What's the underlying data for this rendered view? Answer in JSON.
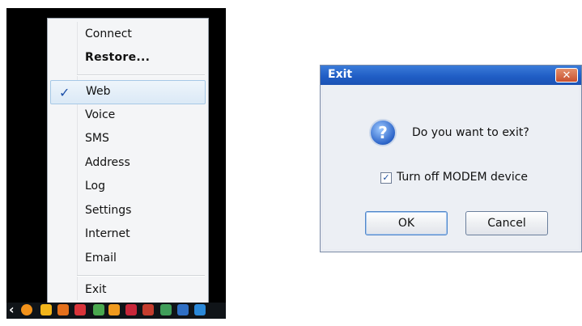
{
  "context_menu": {
    "items": [
      {
        "label": "Connect",
        "bold": false,
        "checked": false
      },
      {
        "label": "Restore...",
        "bold": true,
        "checked": false
      },
      {
        "label": "Web",
        "bold": false,
        "checked": true
      },
      {
        "label": "Voice",
        "bold": false,
        "checked": false
      },
      {
        "label": "SMS",
        "bold": false,
        "checked": false
      },
      {
        "label": "Address",
        "bold": false,
        "checked": false
      },
      {
        "label": "Log",
        "bold": false,
        "checked": false
      },
      {
        "label": "Settings",
        "bold": false,
        "checked": false
      },
      {
        "label": "Internet",
        "bold": false,
        "checked": false
      },
      {
        "label": "Email",
        "bold": false,
        "checked": false
      },
      {
        "label": "Exit",
        "bold": false,
        "checked": false
      }
    ],
    "check_glyph": "✓"
  },
  "taskbar": {
    "expand_glyph": "‹",
    "tray_icons": [
      "orange-round-icon",
      "clock-icon",
      "flame-icon",
      "shield-icon",
      "network-icon",
      "modem-icon",
      "cross-icon",
      "user-icon",
      "display-icon",
      "language-icon"
    ]
  },
  "exit_dialog": {
    "title": "Exit",
    "close_glyph": "✕",
    "question_glyph": "?",
    "message": "Do you want to exit?",
    "checkbox_label": "Turn off MODEM device",
    "checkbox_checked": true,
    "checkbox_glyph": "✓",
    "ok_label": "OK",
    "cancel_label": "Cancel"
  },
  "colors": {
    "titlebar": "#1f5cc4",
    "selection": "#dbe9f6",
    "check": "#1b4fa8"
  }
}
